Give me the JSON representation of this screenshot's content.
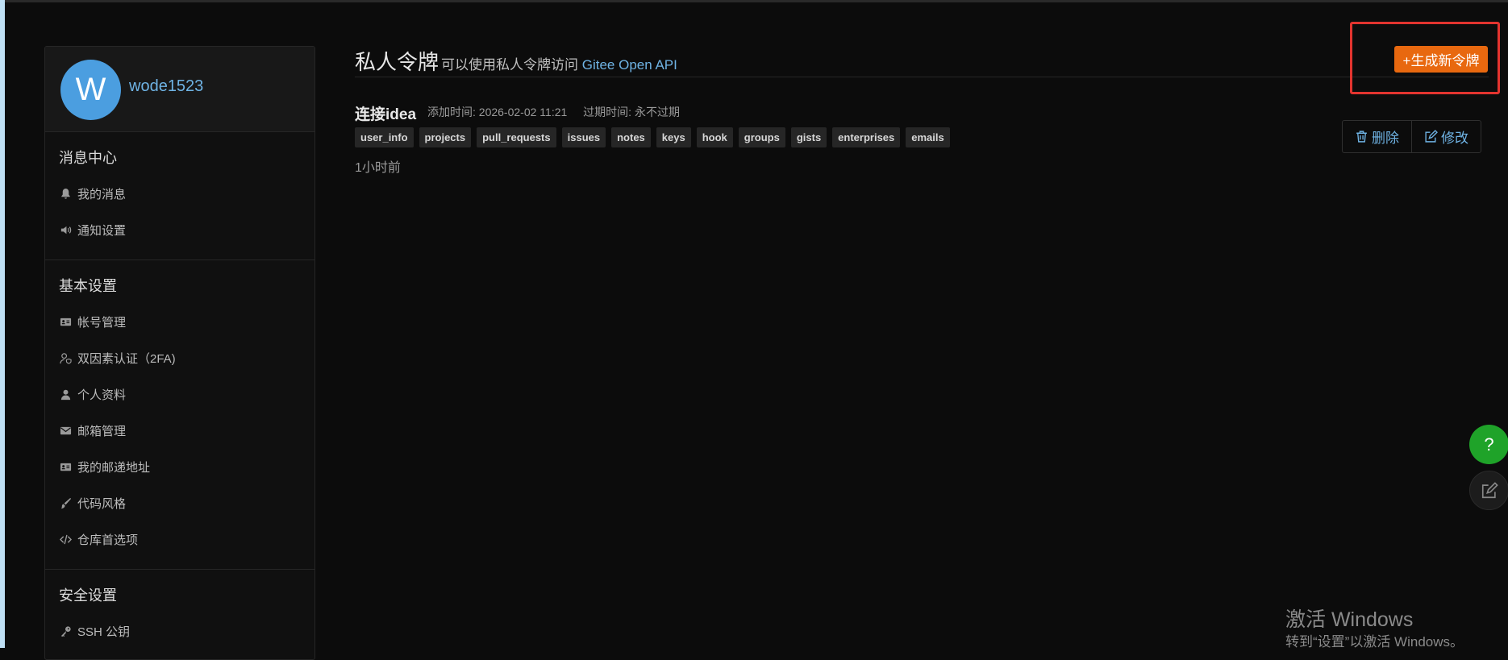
{
  "profile": {
    "avatar_letter": "W",
    "username": "wode1523"
  },
  "sidebar": {
    "sections": [
      {
        "title": "消息中心",
        "items": [
          {
            "label": "我的消息",
            "icon": "bell-icon"
          },
          {
            "label": "通知设置",
            "icon": "speaker-icon"
          }
        ]
      },
      {
        "title": "基本设置",
        "items": [
          {
            "label": "帐号管理",
            "icon": "id-card-icon"
          },
          {
            "label": "双因素认证（2FA)",
            "icon": "user-shield-icon"
          },
          {
            "label": "个人资料",
            "icon": "user-icon"
          },
          {
            "label": "邮箱管理",
            "icon": "envelope-icon"
          },
          {
            "label": "我的邮递地址",
            "icon": "address-card-icon"
          },
          {
            "label": "代码风格",
            "icon": "brush-icon"
          },
          {
            "label": "仓库首选项",
            "icon": "code-icon"
          }
        ]
      },
      {
        "title": "安全设置",
        "items": [
          {
            "label": "SSH 公钥",
            "icon": "key-icon"
          }
        ]
      }
    ]
  },
  "header": {
    "title": "私人令牌",
    "subtitle_prefix": "可以使用私人令牌访问",
    "subtitle_link": "Gitee Open API",
    "new_token_button": "+生成新令牌"
  },
  "token": {
    "name": "连接idea",
    "added": "添加时间: 2026-02-02 11:21",
    "expires": "过期时间: 永不过期",
    "scopes": [
      "user_info",
      "projects",
      "pull_requests",
      "issues",
      "notes",
      "keys",
      "hook",
      "groups",
      "gists",
      "enterprises",
      "emails"
    ],
    "relative_time": "1小时前",
    "delete_label": "删除",
    "edit_label": "修改"
  },
  "floating": {
    "help_symbol": "?"
  },
  "watermark": {
    "line1": "激活 Windows",
    "line2": "转到“设置”以激活 Windows。"
  },
  "colors": {
    "accent": "#e8680f",
    "link": "#6fb3e4",
    "help": "#1fa329",
    "highlight": "#e3342f"
  }
}
